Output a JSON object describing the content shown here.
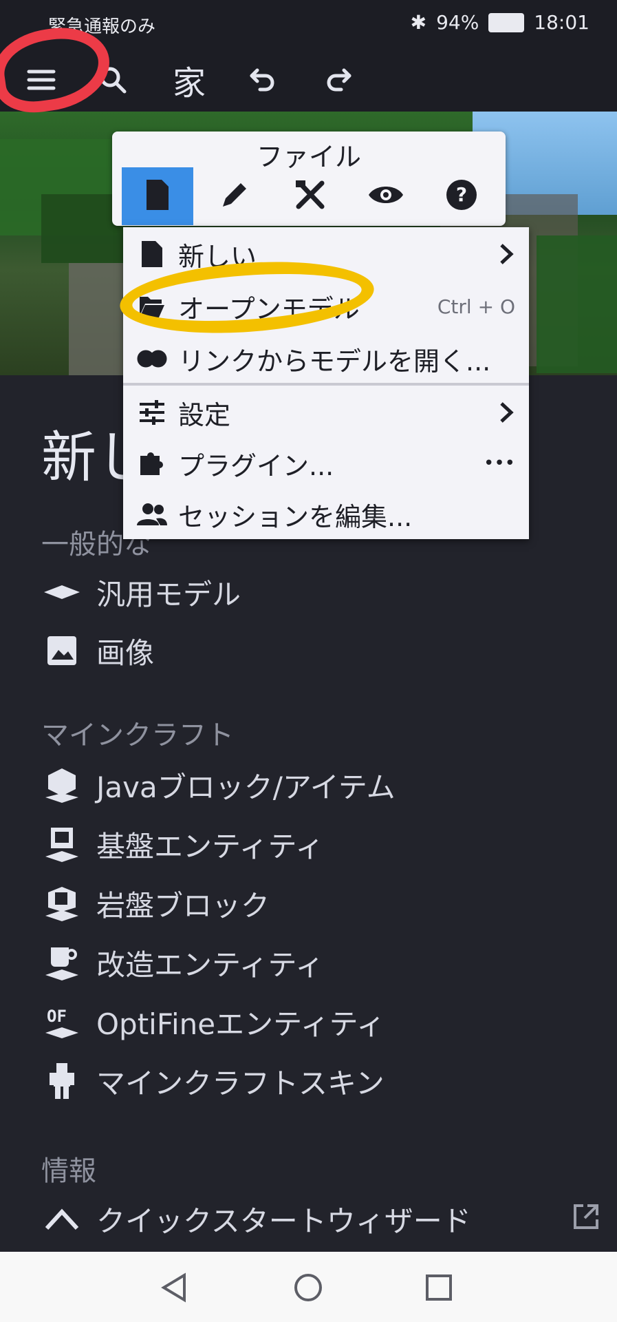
{
  "status_bar": {
    "carrier": "緊急通報のみ",
    "battery": "94%",
    "time": "18:01"
  },
  "toolbar": {
    "menu_icon": "hamburger-icon",
    "search_icon": "search-icon",
    "home_label": "家",
    "undo_icon": "undo-icon",
    "redo_icon": "redo-icon"
  },
  "file_menu": {
    "title": "ファイル",
    "tabs": [
      {
        "icon": "file-icon",
        "selected": true
      },
      {
        "icon": "pencil-icon",
        "selected": false
      },
      {
        "icon": "tools-icon",
        "selected": false
      },
      {
        "icon": "eye-icon",
        "selected": false
      },
      {
        "icon": "help-icon",
        "selected": false
      }
    ],
    "items": [
      {
        "label": "新しい",
        "icon": "file-icon",
        "submenu": true
      },
      {
        "label": "オープンモデル",
        "icon": "folder-open-icon",
        "shortcut": "Ctrl + O"
      },
      {
        "label": "リンクからモデルを開く...",
        "icon": "link-icon"
      },
      {
        "label": "設定",
        "icon": "sliders-icon",
        "submenu": true
      },
      {
        "label": "プラグイン...",
        "icon": "puzzle-icon",
        "more": "•••"
      },
      {
        "label": "セッションを編集...",
        "icon": "people-icon"
      }
    ]
  },
  "start_screen": {
    "heading": "新し",
    "sections": [
      {
        "title": "一般的な",
        "items": [
          {
            "label": "汎用モデル",
            "icon": "plane-icon"
          },
          {
            "label": "画像",
            "icon": "image-icon"
          }
        ]
      },
      {
        "title": "マインクラフト",
        "items": [
          {
            "label": "Javaブロック/アイテム",
            "icon": "java-block-icon"
          },
          {
            "label": "基盤エンティティ",
            "icon": "bedrock-entity-icon"
          },
          {
            "label": "岩盤ブロック",
            "icon": "bedrock-block-icon"
          },
          {
            "label": "改造エンティティ",
            "icon": "modded-entity-icon"
          },
          {
            "label": "OptiFineエンティティ",
            "icon": "optifine-icon"
          },
          {
            "label": "マインクラフトスキン",
            "icon": "skin-icon"
          }
        ]
      },
      {
        "title": "情報",
        "items": [
          {
            "label": "クイックスタートウィザード",
            "icon": "caret-up-icon",
            "external": "external-link-icon"
          }
        ]
      }
    ]
  },
  "colors": {
    "background": "#22232b",
    "menu_bg": "#f3f3f8",
    "accent": "#3a8ee6",
    "red_annotation": "#ec3b47",
    "yellow_annotation": "#f3c000"
  }
}
